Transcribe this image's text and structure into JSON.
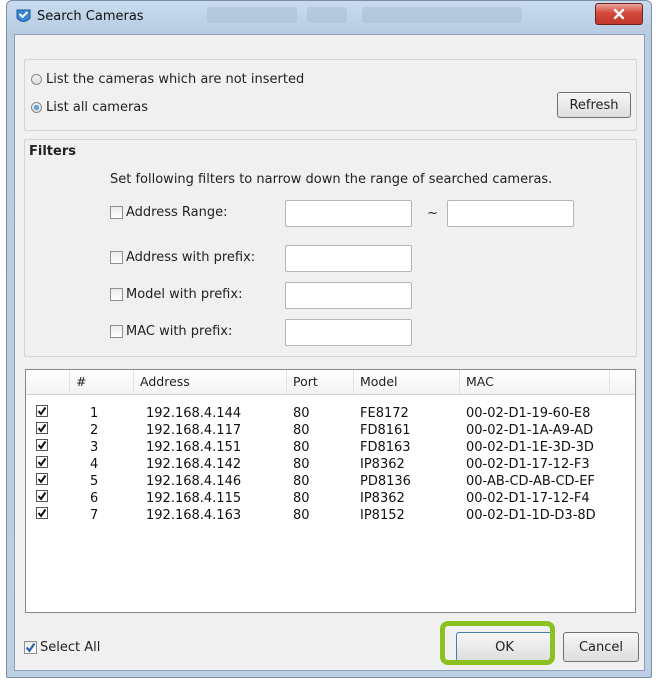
{
  "window": {
    "title": "Search Cameras",
    "close_icon": "close-icon",
    "app_icon": "camera-search-icon"
  },
  "mode": {
    "option_not_inserted": "List the cameras which are not inserted",
    "option_all": "List all cameras",
    "selected": "List all cameras",
    "refresh_label": "Refresh"
  },
  "filters": {
    "heading": "Filters",
    "description": "Set following filters to narrow down the range of searched cameras.",
    "address_range_label": "Address Range:",
    "range_separator": "~",
    "address_prefix_label": "Address with prefix:",
    "model_prefix_label": "Model with prefix:",
    "mac_prefix_label": "MAC with prefix:",
    "address_range_from": "",
    "address_range_to": "",
    "address_prefix_value": "",
    "model_prefix_value": "",
    "mac_prefix_value": ""
  },
  "table": {
    "columns": [
      "#",
      "Address",
      "Port",
      "Model",
      "MAC"
    ],
    "rows": [
      {
        "checked": true,
        "num": "1",
        "address": "192.168.4.144",
        "port": "80",
        "model": "FE8172",
        "mac": "00-02-D1-19-60-E8"
      },
      {
        "checked": true,
        "num": "2",
        "address": "192.168.4.117",
        "port": "80",
        "model": "FD8161",
        "mac": "00-02-D1-1A-A9-AD"
      },
      {
        "checked": true,
        "num": "3",
        "address": "192.168.4.151",
        "port": "80",
        "model": "FD8163",
        "mac": "00-02-D1-1E-3D-3D"
      },
      {
        "checked": true,
        "num": "4",
        "address": "192.168.4.142",
        "port": "80",
        "model": "IP8362",
        "mac": "00-02-D1-17-12-F3"
      },
      {
        "checked": true,
        "num": "5",
        "address": "192.168.4.146",
        "port": "80",
        "model": "PD8136",
        "mac": "00-AB-CD-AB-CD-EF"
      },
      {
        "checked": true,
        "num": "6",
        "address": "192.168.4.115",
        "port": "80",
        "model": "IP8362",
        "mac": "00-02-D1-17-12-F4"
      },
      {
        "checked": true,
        "num": "7",
        "address": "192.168.4.163",
        "port": "80",
        "model": "IP8152",
        "mac": "00-02-D1-1D-D3-8D"
      }
    ]
  },
  "footer": {
    "select_all_label": "Select All",
    "select_all_checked": true,
    "ok_label": "OK",
    "cancel_label": "Cancel"
  },
  "colors": {
    "highlight": "#8bc21f",
    "close_button": "#c0392b"
  }
}
